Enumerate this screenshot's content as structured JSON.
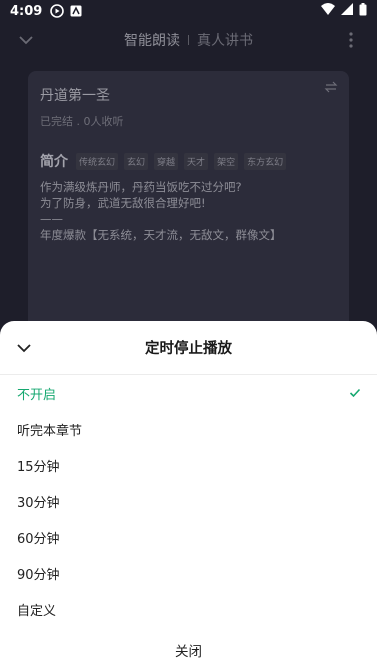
{
  "status_bar": {
    "time": "4:09"
  },
  "app_bar": {
    "tab_tts": "智能朗读",
    "tab_human": "真人讲书"
  },
  "book": {
    "title": "丹道第一圣",
    "status": "已完结 . 0人收听",
    "intro_label": "简介",
    "tags": [
      "传统玄幻",
      "玄幻",
      "穿越",
      "天才",
      "架空",
      "东方玄幻"
    ],
    "desc_lines": [
      "作为满级炼丹师，丹药当饭吃不过分吧?",
      "为了防身，武道无敌很合理好吧!",
      "——",
      "年度爆款【无系统，天才流，无敌文，群像文】"
    ]
  },
  "sheet": {
    "title": "定时停止播放",
    "options": [
      {
        "label": "不开启",
        "selected": true
      },
      {
        "label": "听完本章节",
        "selected": false
      },
      {
        "label": "15分钟",
        "selected": false
      },
      {
        "label": "30分钟",
        "selected": false
      },
      {
        "label": "60分钟",
        "selected": false
      },
      {
        "label": "90分钟",
        "selected": false
      },
      {
        "label": "自定义",
        "selected": false
      }
    ],
    "close_label": "关闭"
  },
  "colors": {
    "accent": "#16a870",
    "overlay_bg": "#1e1e2a"
  }
}
